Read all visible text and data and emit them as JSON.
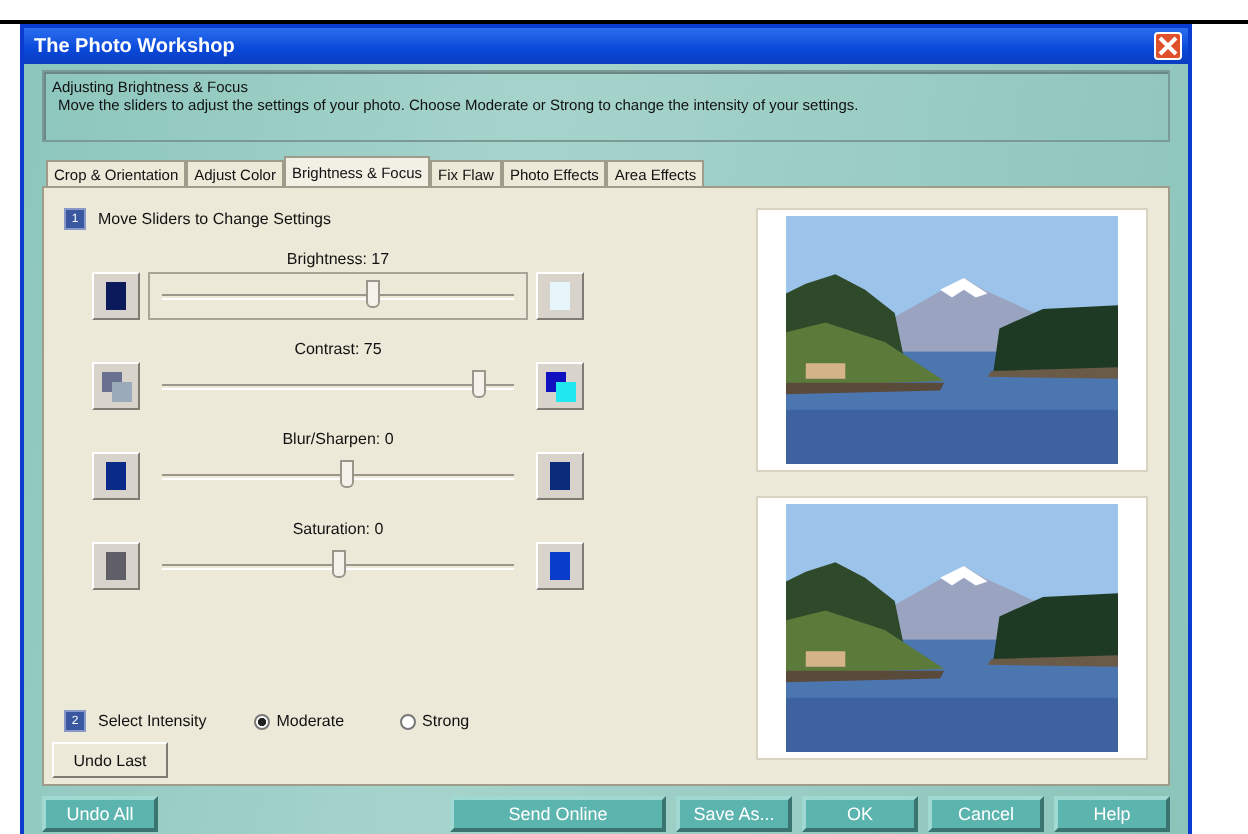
{
  "window": {
    "title": "The Photo Workshop"
  },
  "info": {
    "heading": "Adjusting Brightness & Focus",
    "text": "Move the sliders to adjust the settings of your photo. Choose Moderate or Strong to change the intensity of your settings."
  },
  "tabs": [
    {
      "label": "Crop & Orientation",
      "selected": false
    },
    {
      "label": "Adjust Color",
      "selected": false
    },
    {
      "label": "Brightness & Focus",
      "selected": true
    },
    {
      "label": "Fix Flaw",
      "selected": false
    },
    {
      "label": "Photo Effects",
      "selected": false
    },
    {
      "label": "Area Effects",
      "selected": false
    }
  ],
  "step1": {
    "number": "1",
    "label": "Move Sliders to Change Settings"
  },
  "sliders": [
    {
      "label": "Brightness:  17",
      "level": 0.59,
      "kind": "brightness"
    },
    {
      "label": "Contrast:  75",
      "level": 0.87,
      "kind": "contrast"
    },
    {
      "label": "Blur/Sharpen:  0",
      "level": 0.52,
      "kind": "sharpen"
    },
    {
      "label": "Saturation:  0",
      "level": 0.5,
      "kind": "saturation"
    }
  ],
  "step2": {
    "number": "2",
    "label": "Select Intensity"
  },
  "intensity": [
    {
      "label": "Moderate",
      "selected": true
    },
    {
      "label": "Strong",
      "selected": false
    }
  ],
  "undo_last": "Undo Last",
  "buttons": [
    {
      "label": "Undo All",
      "kind": "left"
    },
    {
      "label": "Send Online",
      "kind": "right"
    },
    {
      "label": "Save As...",
      "kind": "right"
    },
    {
      "label": "OK",
      "kind": "right"
    },
    {
      "label": "Cancel",
      "kind": "right"
    },
    {
      "label": "Help",
      "kind": "right"
    }
  ]
}
